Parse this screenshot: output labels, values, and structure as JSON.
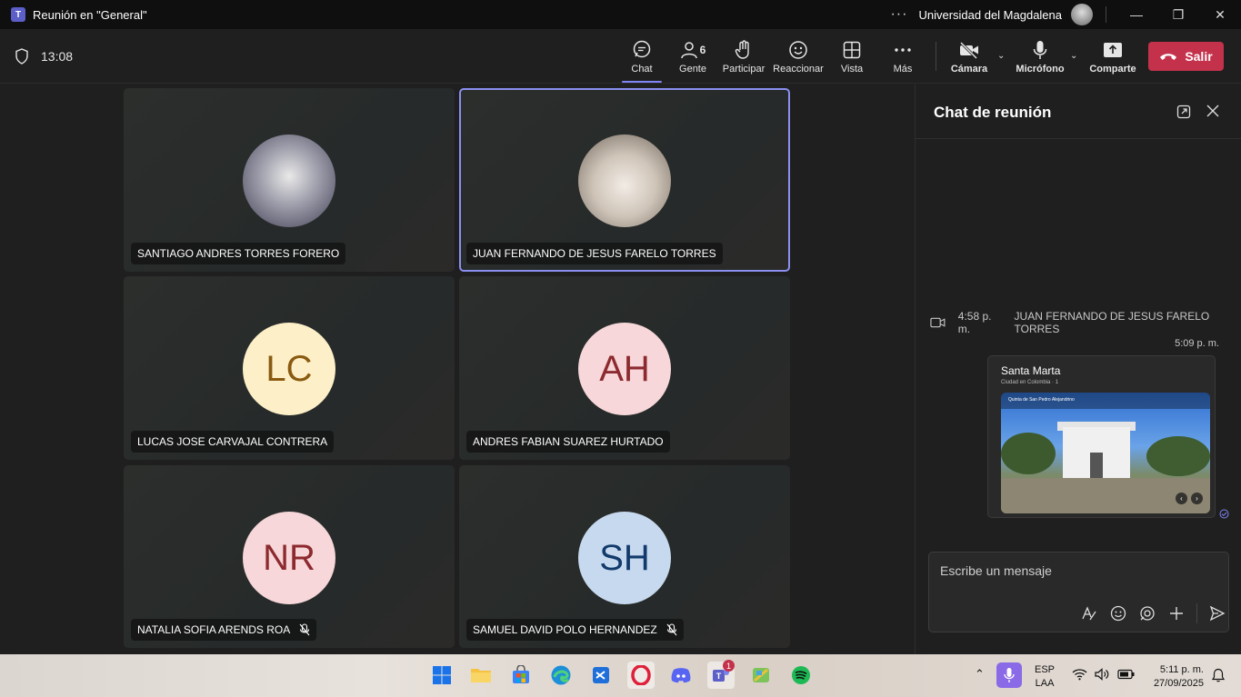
{
  "window": {
    "title": "Reunión en \"General\"",
    "organization": "Universidad del Magdalena",
    "more_label": "···",
    "minimize_label": "—",
    "maximize_label": "❐",
    "close_label": "✕"
  },
  "toolbar": {
    "timer": "13:08",
    "chat_label": "Chat",
    "people_label": "Gente",
    "people_count": "6",
    "raise_label": "Participar",
    "react_label": "Reaccionar",
    "view_label": "Vista",
    "more_label": "Más",
    "camera_label": "Cámara",
    "mic_label": "Micrófono",
    "share_label": "Comparte",
    "leave_label": "Salir"
  },
  "participants": [
    {
      "name": "SANTIAGO ANDRES TORRES FORERO",
      "initials": "",
      "muted": false
    },
    {
      "name": "JUAN FERNANDO DE JESUS FARELO TORRES",
      "initials": "",
      "muted": false
    },
    {
      "name": "LUCAS JOSE CARVAJAL CONTRERA",
      "initials": "LC",
      "muted": false
    },
    {
      "name": "ANDRES FABIAN SUAREZ HURTADO",
      "initials": "AH",
      "muted": false
    },
    {
      "name": "NATALIA SOFIA ARENDS ROA",
      "initials": "NR",
      "muted": true
    },
    {
      "name": "SAMUEL DAVID POLO HERNANDEZ",
      "initials": "SH",
      "muted": true
    }
  ],
  "chat": {
    "title": "Chat de reunión",
    "meeting_event": {
      "time": "4:58 p. m.",
      "name": "JUAN FERNANDO DE JESUS FARELO TORRES"
    },
    "message_time": "5:09 p. m.",
    "card": {
      "title": "Santa Marta",
      "subtitle": "Ciudad en Colombia · 1",
      "place": "Quinta de San Pedro Alejandrino"
    },
    "compose_placeholder": "Escribe un mensaje"
  },
  "taskbar": {
    "lang_top": "ESP",
    "lang_bottom": "LAA",
    "time": "5:11 p. m.",
    "date": "27/09/2025",
    "teams_badge": "1"
  },
  "colors": {
    "accent": "#7f85f5",
    "leave": "#c4314b",
    "lc_bg": "#fdf0c8",
    "lc_fg": "#8a5a10",
    "ah_bg": "#f7d7d9",
    "ah_fg": "#8c2a2f",
    "nr_bg": "#f7d7d9",
    "nr_fg": "#8c2a2f",
    "sh_bg": "#c7d9ee",
    "sh_fg": "#123a6b"
  }
}
